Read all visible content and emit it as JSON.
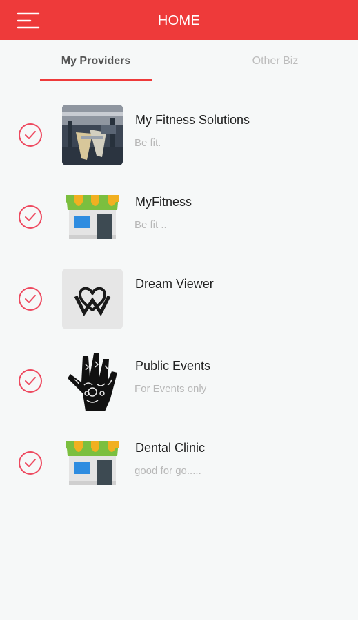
{
  "header": {
    "title": "HOME",
    "menu_icon": "menu-icon",
    "color": "#ee3a3a"
  },
  "tabs": [
    {
      "label": "My Providers",
      "active": true
    },
    {
      "label": "Other Biz",
      "active": false
    }
  ],
  "providers": [
    {
      "name": "My Fitness Solutions",
      "subtitle": "Be fit.",
      "image": "gym-photo",
      "checked": true
    },
    {
      "name": "MyFitness",
      "subtitle": "Be fit ..",
      "image": "store-icon",
      "checked": true
    },
    {
      "name": "Dream Viewer",
      "subtitle": "",
      "image": "heart-logo-icon",
      "checked": true
    },
    {
      "name": "Public Events",
      "subtitle": "For Events only",
      "image": "patterned-hand-icon",
      "checked": true
    },
    {
      "name": "Dental Clinic",
      "subtitle": "good for go.....",
      "image": "store-icon",
      "checked": true
    }
  ]
}
